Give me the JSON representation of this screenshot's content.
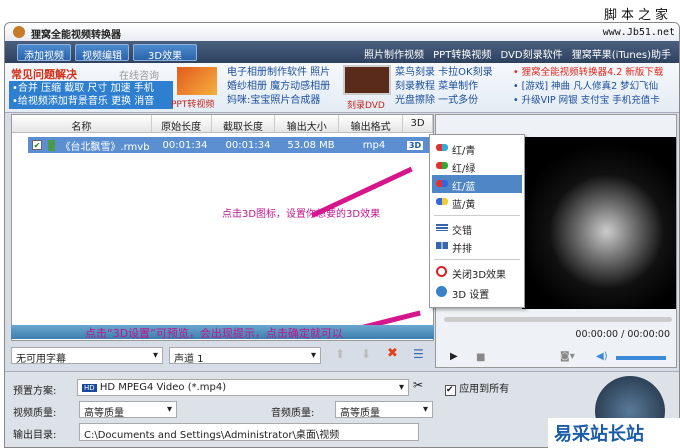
{
  "watermark": {
    "top": "脚本之家",
    "url": "www.Jb51.net",
    "bottom": "易采站长站"
  },
  "window": {
    "title": "狸窝全能视频转换器"
  },
  "toolbar": {
    "buttons": [
      "添加视频",
      "视频编辑",
      "3D效果"
    ],
    "links": [
      "照片制作视频",
      "PPT转换视频",
      "DVD刻录软件",
      "狸窝苹果(iTunes)助手"
    ]
  },
  "promo": {
    "faq_title": "常见问题解决",
    "consult": "在线咨询",
    "faq_lines": [
      "•合并 压缩 截取 尺寸 加速 手机",
      "•给视频添加背景音乐 更换 消音"
    ],
    "ppt_label": "PPT转视频",
    "ppt_links": [
      "电子相册制作软件 照片",
      "婚纱相册 魔方动感相册",
      "妈咪:宝宝照片合成器"
    ],
    "dvd_label": "刻录DVD",
    "dvd_links": [
      "菜鸟刻录 卡拉OK刻录",
      "刻录教程 菜单制作",
      "光盘擦除 一式多份"
    ],
    "news": [
      "• 狸窝全能视频转换器4.2 新版下载",
      "• [游戏] 神曲 凡人修真2 梦幻飞仙",
      "• 升级VIP 网银 支付宝 手机充值卡"
    ]
  },
  "file_list": {
    "columns": [
      "名称",
      "原始长度",
      "截取长度",
      "输出大小",
      "输出格式",
      "3D"
    ],
    "rows": [
      {
        "name": "《台北飘雪》.rmvb",
        "orig": "00:01:34",
        "clip": "00:01:34",
        "size": "53.08 MB",
        "format": "mp4"
      }
    ]
  },
  "menu_3d": {
    "items": [
      "红/青",
      "红/绿",
      "红/蓝",
      "蓝/黄",
      "交错",
      "并排",
      "关闭3D效果",
      "3D 设置"
    ],
    "selected": "红/蓝"
  },
  "annotations": {
    "a1": "点击3D图标，设置你想要的3D效果",
    "a2": "点击“3D设置”可预览，会出现提示，点击确定就可以"
  },
  "player": {
    "time": "00:00:00 / 00:00:00"
  },
  "controls": {
    "subtitle": "无可用字幕",
    "audio": "声道 1"
  },
  "settings": {
    "preset_label": "预置方案:",
    "preset": "HD MPEG4 Video (*.mp4)",
    "apply_all": "应用到所有",
    "video_q_label": "视频质量:",
    "video_q": "高等质量",
    "audio_q_label": "音频质量:",
    "audio_q": "高等质量",
    "output_label": "输出目录:",
    "output": "C:\\Documents and Settings\\Administrator\\桌面\\视频"
  }
}
